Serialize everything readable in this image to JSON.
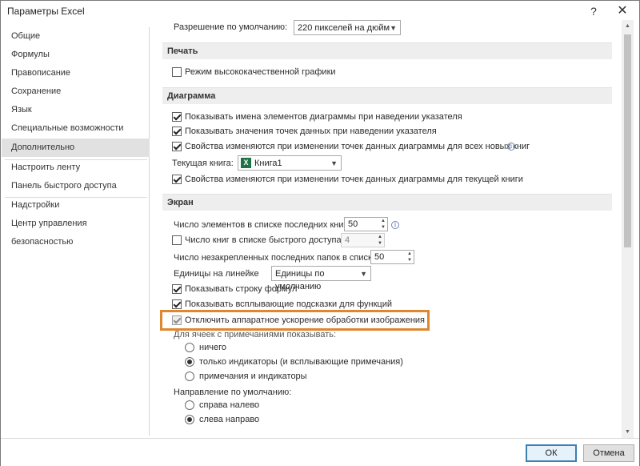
{
  "window": {
    "title": "Параметры Excel",
    "help_glyph": "?",
    "close_glyph": "✕"
  },
  "sidebar": {
    "items": [
      {
        "label": "Общие"
      },
      {
        "label": "Формулы"
      },
      {
        "label": "Правописание"
      },
      {
        "label": "Сохранение"
      },
      {
        "label": "Язык"
      },
      {
        "label": "Специальные возможности"
      },
      {
        "label": "Дополнительно",
        "active": true
      },
      {
        "label": "Настроить ленту"
      },
      {
        "label": "Панель быстрого доступа"
      },
      {
        "label": "Надстройки"
      },
      {
        "label": "Центр управления безопасностью"
      }
    ]
  },
  "top_partial": {
    "label": "Разрешение по умолчанию:",
    "value": "220 пикселей на дюйм"
  },
  "print": {
    "header": "Печать",
    "high_quality": {
      "label": "Режим высококачественной графики",
      "checked": false
    }
  },
  "chart": {
    "header": "Диаграмма",
    "show_names": {
      "label": "Показывать имена элементов диаграммы при наведении указателя",
      "checked": true
    },
    "show_values": {
      "label": "Показывать значения точек данных при наведении указателя",
      "checked": true
    },
    "props_all": {
      "label": "Свойства изменяются при изменении точек данных диаграммы для всех новых книг",
      "checked": true
    },
    "current_book_label": "Текущая книга:",
    "current_book_value": "Книга1",
    "excel_icon_letter": "X",
    "props_current": {
      "label": "Свойства изменяются при изменении точек данных диаграммы для текущей книги",
      "checked": true
    }
  },
  "screen": {
    "header": "Экран",
    "recent_books": {
      "label": "Число элементов в списке последних книг:",
      "value": "50"
    },
    "quick_access": {
      "label": "Число книг в списке быстрого доступа",
      "value": "4",
      "checked": false
    },
    "unpinned_folders": {
      "label": "Число незакрепленных последних папок в списке:",
      "value": "50"
    },
    "ruler_units": {
      "label": "Единицы на линейке",
      "value": "Единицы по умолчанию"
    },
    "formula_bar": {
      "label": "Показывать строку формул",
      "checked": true
    },
    "function_tips": {
      "label": "Показывать всплывающие подсказки для функций",
      "checked": true
    },
    "hw_accel": {
      "label": "Отключить аппаратное ускорение обработки изображения",
      "checked": true
    },
    "comments_label": "Для ячеек с примечаниями показывать:",
    "comments_options": [
      {
        "label": "ничего",
        "checked": false
      },
      {
        "label": "только индикаторы (и всплывающие примечания)",
        "checked": true
      },
      {
        "label": "примечания и индикаторы",
        "checked": false
      }
    ],
    "direction_label": "Направление по умолчанию:",
    "direction_options": [
      {
        "label": "справа налево",
        "checked": false
      },
      {
        "label": "слева направо",
        "checked": true
      }
    ]
  },
  "footer": {
    "ok": "ОК",
    "cancel": "Отмена"
  },
  "colors": {
    "highlight": "#e0862e",
    "sidebar_active": "#e1e1e1",
    "section_bg": "#eeeeee"
  }
}
